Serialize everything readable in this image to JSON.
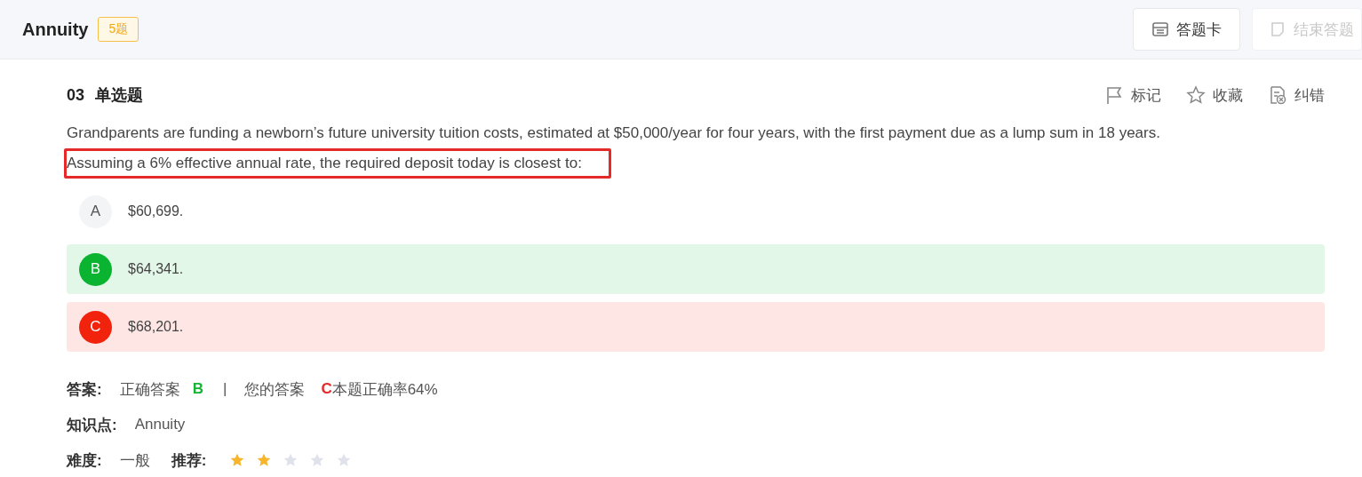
{
  "header": {
    "title": "Annuity",
    "count_badge": "5题",
    "buttons": [
      {
        "label": "答题卡",
        "disabled": false
      },
      {
        "label": "结束答题",
        "disabled": true
      }
    ]
  },
  "question": {
    "number": "03",
    "type": "单选题",
    "actions": [
      {
        "label": "标记"
      },
      {
        "label": "收藏"
      },
      {
        "label": "纠错"
      }
    ],
    "lines": [
      {
        "text": "Grandparents are funding a newborn’s future university tuition costs, estimated at $50,000/year for four years, with the first payment due as a lump sum in 18 years.",
        "highlighted": false
      },
      {
        "text": "Assuming a 6% effective annual rate, the required deposit today is closest to:",
        "highlighted": true
      }
    ],
    "options": [
      {
        "letter": "A",
        "text": "$60,699.",
        "correct": false,
        "selected": false
      },
      {
        "letter": "B",
        "text": "$64,341.",
        "correct": true,
        "selected": false
      },
      {
        "letter": "C",
        "text": "$68,201.",
        "correct": false,
        "selected": true
      }
    ]
  },
  "answer": {
    "label": "答案:",
    "correct_label": "正确答案",
    "correct": "B",
    "divider": "|",
    "yours_label": "您的答案",
    "yours": "C",
    "rate": "本题正确率64%"
  },
  "knowledge": {
    "label": "知识点:",
    "value": "Annuity"
  },
  "difficulty": {
    "label": "难度:",
    "value": "一般"
  },
  "recommend": {
    "label": "推荐:",
    "stars": 2
  }
}
